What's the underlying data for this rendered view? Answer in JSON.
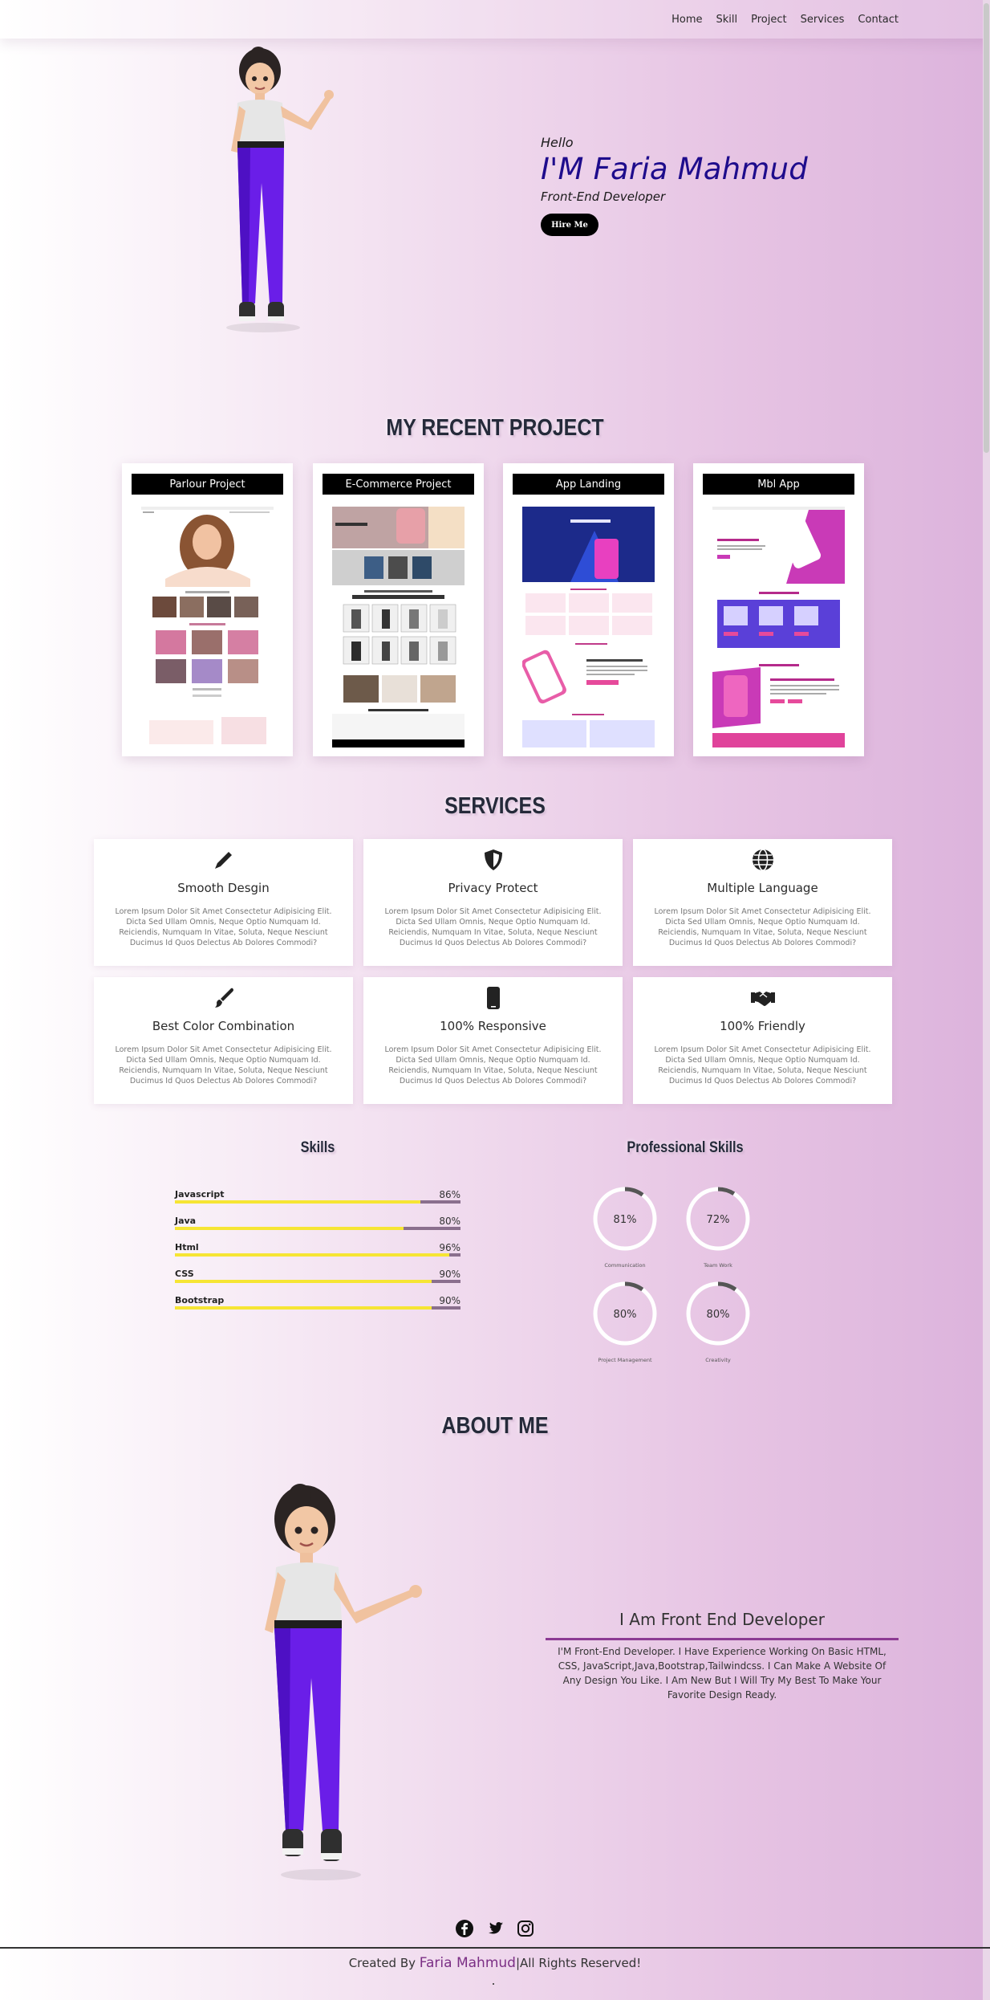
{
  "nav": {
    "links": [
      "Home",
      "Skill",
      "Project",
      "Services",
      "Contact"
    ]
  },
  "hero": {
    "hello": "Hello",
    "name": "I'M Faria Mahmud",
    "role": "Front-End Developer",
    "button": "Hire Me"
  },
  "projects": {
    "title": "MY RECENT PROJECT",
    "items": [
      {
        "title": "Parlour Project"
      },
      {
        "title": "E-Commerce Project"
      },
      {
        "title": "App Landing"
      },
      {
        "title": "Mbl App"
      }
    ]
  },
  "services": {
    "title": "SERVICES",
    "items": [
      {
        "title": "Smooth Desgin",
        "icon": "pen-icon",
        "desc": "Lorem Ipsum Dolor Sit Amet Consectetur Adipisicing Elit. Dicta Sed Ullam Omnis, Neque Optio Numquam Id. Reiciendis, Numquam In Vitae, Soluta, Neque Nesciunt Ducimus Id Quos Delectus Ab Dolores Commodi?"
      },
      {
        "title": "Privacy Protect",
        "icon": "shield-icon",
        "desc": "Lorem Ipsum Dolor Sit Amet Consectetur Adipisicing Elit. Dicta Sed Ullam Omnis, Neque Optio Numquam Id. Reiciendis, Numquam In Vitae, Soluta, Neque Nesciunt Ducimus Id Quos Delectus Ab Dolores Commodi?"
      },
      {
        "title": "Multiple Language",
        "icon": "globe-icon",
        "desc": "Lorem Ipsum Dolor Sit Amet Consectetur Adipisicing Elit. Dicta Sed Ullam Omnis, Neque Optio Numquam Id. Reiciendis, Numquam In Vitae, Soluta, Neque Nesciunt Ducimus Id Quos Delectus Ab Dolores Commodi?"
      },
      {
        "title": "Best Color Combination",
        "icon": "paintbrush-icon",
        "desc": "Lorem Ipsum Dolor Sit Amet Consectetur Adipisicing Elit. Dicta Sed Ullam Omnis, Neque Optio Numquam Id. Reiciendis, Numquam In Vitae, Soluta, Neque Nesciunt Ducimus Id Quos Delectus Ab Dolores Commodi?"
      },
      {
        "title": "100% Responsive",
        "icon": "mobile-icon",
        "desc": "Lorem Ipsum Dolor Sit Amet Consectetur Adipisicing Elit. Dicta Sed Ullam Omnis, Neque Optio Numquam Id. Reiciendis, Numquam In Vitae, Soluta, Neque Nesciunt Ducimus Id Quos Delectus Ab Dolores Commodi?"
      },
      {
        "title": "100% Friendly",
        "icon": "handshake-icon",
        "desc": "Lorem Ipsum Dolor Sit Amet Consectetur Adipisicing Elit. Dicta Sed Ullam Omnis, Neque Optio Numquam Id. Reiciendis, Numquam In Vitae, Soluta, Neque Nesciunt Ducimus Id Quos Delectus Ab Dolores Commodi?"
      }
    ]
  },
  "skills": {
    "title": "Skills",
    "items": [
      {
        "name": "Javascript",
        "pct": "86%",
        "value": 0.86
      },
      {
        "name": "Java",
        "pct": "80%",
        "value": 0.8
      },
      {
        "name": "Html",
        "pct": "96%",
        "value": 0.96
      },
      {
        "name": "CSS",
        "pct": "90%",
        "value": 0.9
      },
      {
        "name": "Bootstrap",
        "pct": "90%",
        "value": 0.9
      }
    ]
  },
  "professional": {
    "title": "Professional Skills",
    "items": [
      {
        "value_label": "81%",
        "label": "Communication",
        "value": 0.81
      },
      {
        "value_label": "72%",
        "label": "Team Work",
        "value": 0.72
      },
      {
        "value_label": "80%",
        "label": "Project Management",
        "value": 0.8
      },
      {
        "value_label": "80%",
        "label": "Creativity",
        "value": 0.8
      }
    ]
  },
  "about": {
    "title": "ABOUT ME",
    "heading": "I Am Front End Developer",
    "text": "I'M Front-End Developer. I Have Experience Working On Basic HTML, CSS, JavaScript,Java,Bootstrap,Tailwindcss. I Can Make A Website Of Any Design You Like. I Am New But I Will Try My Best To Make Your Favorite Design Ready."
  },
  "footer": {
    "icons": [
      "facebook-icon",
      "twitter-icon",
      "instagram-icon"
    ],
    "created_by": "Created By",
    "name": "Faria Mahmud",
    "rights": "|All Rights Reserved!"
  },
  "colors": {
    "name_blue": "#1e0c8c",
    "skill_bar": "#f6e534",
    "accent_purple": "#7b2f85"
  }
}
